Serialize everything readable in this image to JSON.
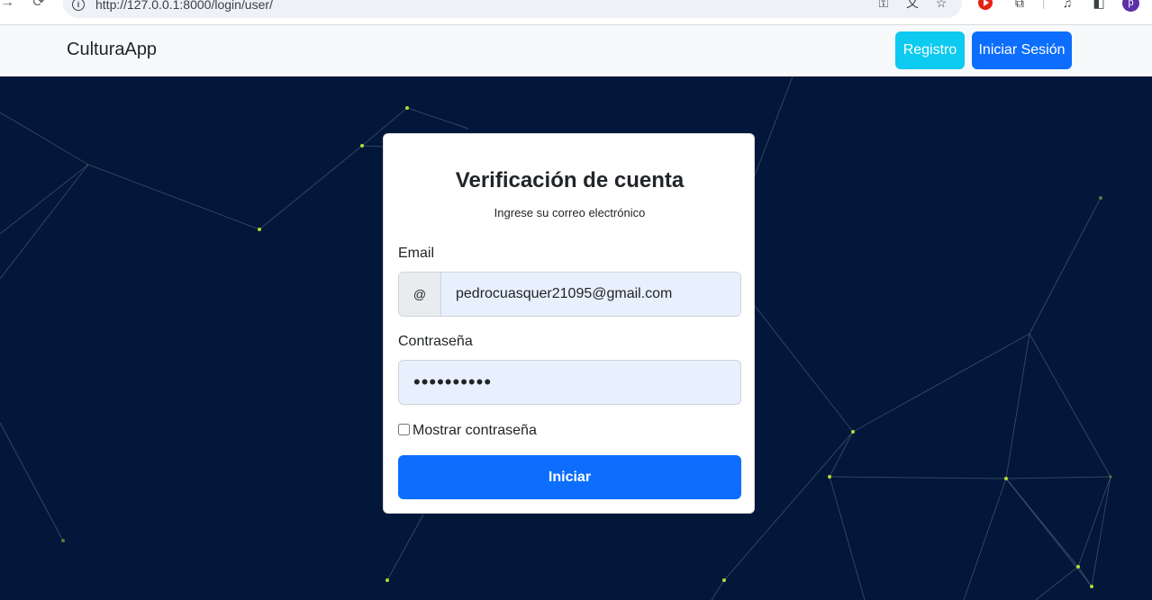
{
  "browser": {
    "url": "http://127.0.0.1:8000/login/user/",
    "profile_initial": "p",
    "icons": [
      "back-arrow-icon",
      "reload-icon",
      "site-info-icon",
      "key-icon",
      "translate-icon",
      "star-icon",
      "youtube-extension-icon",
      "puzzle-extension-icon",
      "media-icon",
      "side-panel-icon",
      "profile-avatar"
    ]
  },
  "navbar": {
    "brand": "CulturaApp",
    "register_label": "Registro",
    "login_label": "Iniciar Sesión",
    "colors": {
      "register": "#0dcaf0",
      "login": "#0d6efd",
      "background": "#f8f9fa"
    }
  },
  "card": {
    "title": "Verificación de cuenta",
    "subtitle": "Ingrese su correo electrónico",
    "email": {
      "label": "Email",
      "addon": "@",
      "value": "pedrocuasquer21095@gmail.com"
    },
    "password": {
      "label": "Contraseña",
      "value": "••••••••••"
    },
    "show_password_label": "Mostrar contraseña",
    "submit_label": "Iniciar"
  },
  "theme": {
    "page_background": "#021739",
    "accent": "#0d6efd",
    "network_node": "#b5d83a"
  }
}
